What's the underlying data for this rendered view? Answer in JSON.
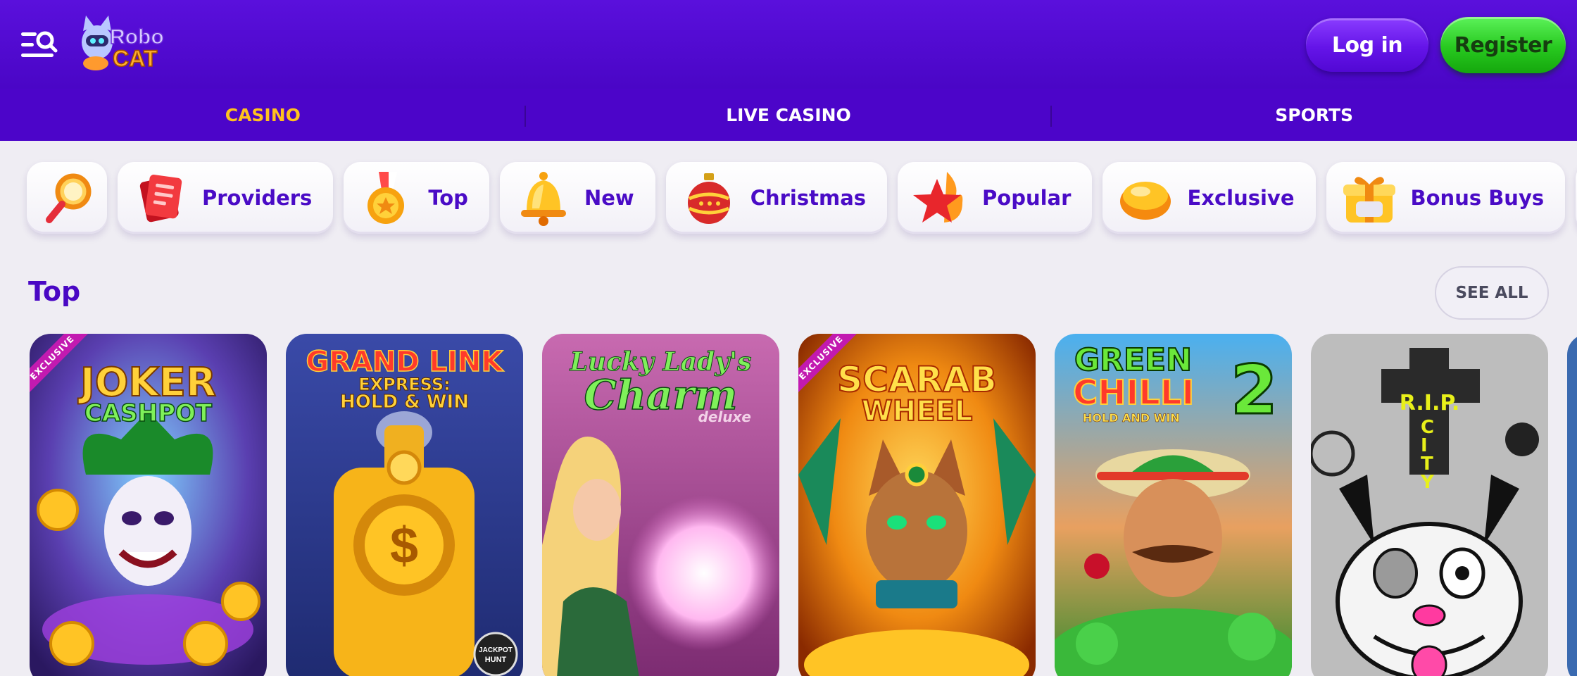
{
  "brand": {
    "logo_line1": "Robo",
    "logo_line2": "CAT"
  },
  "header": {
    "login_label": "Log in",
    "register_label": "Register"
  },
  "subnav": {
    "items": [
      "CASINO",
      "LIVE CASINO",
      "SPORTS"
    ],
    "active_index": 0
  },
  "categories": [
    {
      "label": "",
      "icon": "search-icon"
    },
    {
      "label": "Providers",
      "icon": "providers-icon"
    },
    {
      "label": "Top",
      "icon": "medal-icon"
    },
    {
      "label": "New",
      "icon": "bell-icon"
    },
    {
      "label": "Christmas",
      "icon": "ornament-icon"
    },
    {
      "label": "Popular",
      "icon": "star-flame-icon"
    },
    {
      "label": "Exclusive",
      "icon": "gem-icon"
    },
    {
      "label": "Bonus Buys",
      "icon": "gift-icon"
    },
    {
      "label": "",
      "icon": "play-icon"
    }
  ],
  "section": {
    "title": "Top",
    "see_all_label": "SEE ALL"
  },
  "games": [
    {
      "title_line1": "JOKER",
      "title_line2": "CASHPOT",
      "badge": "EXCLUSIVE"
    },
    {
      "title_line1": "GRAND LINK",
      "title_line2": "EXPRESS:",
      "title_line3": "HOLD & WIN",
      "badge_corner": "JACKPOT HUNT"
    },
    {
      "title_line1": "Lucky Lady's",
      "title_line2": "Charm",
      "title_line3": "deluxe"
    },
    {
      "title_line1": "SCARAB",
      "title_line2": "WHEEL",
      "badge": "EXCLUSIVE"
    },
    {
      "title_line1": "GREEN",
      "title_line2": "CHILLI",
      "title_num": "2",
      "title_line3": "HOLD AND WIN"
    },
    {
      "title_line1": "R.I.P.",
      "title_line2": "CITY"
    }
  ],
  "colors": {
    "header_bg": "#5a10dc",
    "subnav_bg": "#4c05c9",
    "active_nav": "#ffc21e",
    "accent_text": "#4a0bc6",
    "register_green": "#27c81f"
  }
}
